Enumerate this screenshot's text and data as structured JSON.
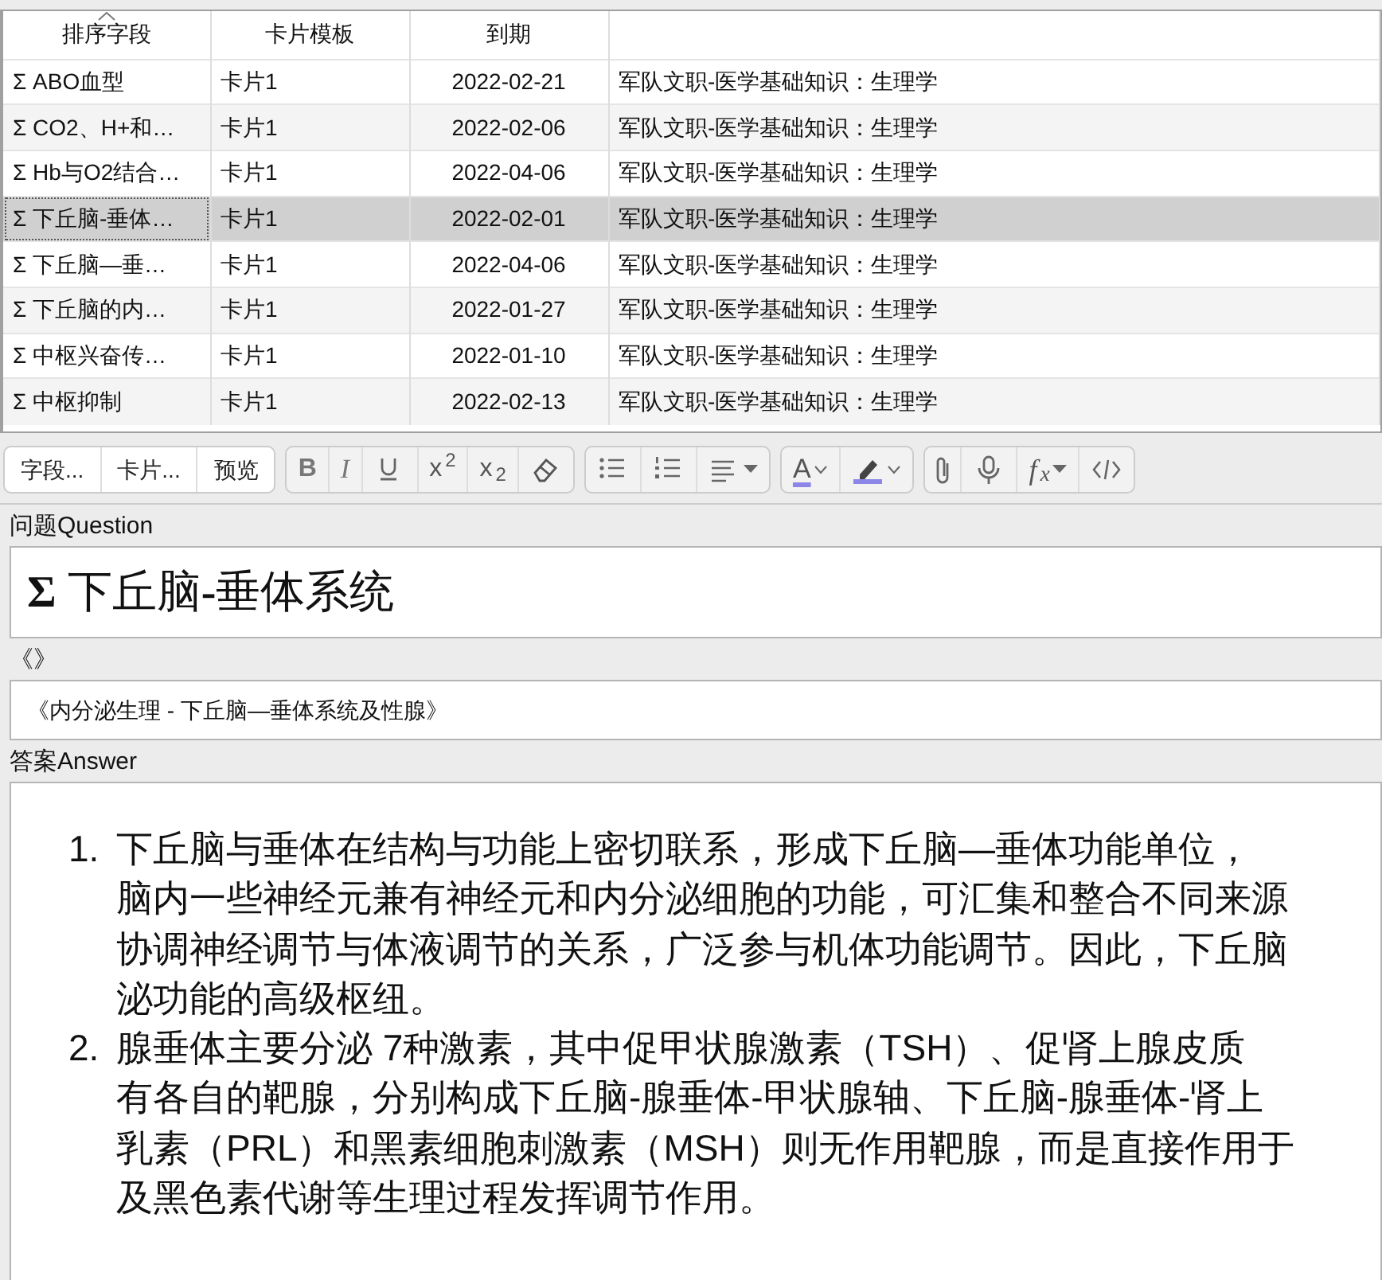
{
  "table": {
    "columns": [
      {
        "label": "排序字段",
        "sorted": true
      },
      {
        "label": "卡片模板",
        "sorted": false
      },
      {
        "label": "到期",
        "sorted": false
      }
    ],
    "rows": [
      {
        "cells": [
          "Σ ABO血型",
          "卡片1",
          "2022-02-21",
          "军队文职-医学基础知识：生理学"
        ],
        "selected": false
      },
      {
        "cells": [
          "Σ CO2、H+和…",
          "卡片1",
          "2022-02-06",
          "军队文职-医学基础知识：生理学"
        ],
        "selected": false
      },
      {
        "cells": [
          "Σ Hb与O2结合…",
          "卡片1",
          "2022-04-06",
          "军队文职-医学基础知识：生理学"
        ],
        "selected": false
      },
      {
        "cells": [
          "Σ 下丘脑-垂体…",
          "卡片1",
          "2022-02-01",
          "军队文职-医学基础知识：生理学"
        ],
        "selected": true
      },
      {
        "cells": [
          "Σ 下丘脑—垂…",
          "卡片1",
          "2022-04-06",
          "军队文职-医学基础知识：生理学"
        ],
        "selected": false
      },
      {
        "cells": [
          "Σ 下丘脑的内…",
          "卡片1",
          "2022-01-27",
          "军队文职-医学基础知识：生理学"
        ],
        "selected": false
      },
      {
        "cells": [
          "Σ 中枢兴奋传…",
          "卡片1",
          "2022-01-10",
          "军队文职-医学基础知识：生理学"
        ],
        "selected": false
      },
      {
        "cells": [
          "Σ 中枢抑制",
          "卡片1",
          "2022-02-13",
          "军队文职-医学基础知识：生理学"
        ],
        "selected": false
      }
    ]
  },
  "toolbar": {
    "text_buttons": [
      "字段...",
      "卡片...",
      "预览"
    ],
    "groups": [
      [
        {
          "kind": "bold",
          "glyph": "B"
        },
        {
          "kind": "italic",
          "glyph": "I"
        },
        {
          "kind": "underline"
        },
        {
          "kind": "superscript",
          "glyph": "x$^{2}$"
        },
        {
          "kind": "subscript",
          "glyph": "x$_{2}$"
        },
        {
          "kind": "eraser"
        }
      ],
      [
        {
          "kind": "bullets"
        },
        {
          "kind": "numbers"
        },
        {
          "kind": "align"
        }
      ],
      [
        {
          "kind": "text-color",
          "glyph": "A"
        },
        {
          "kind": "highlight"
        }
      ],
      [
        {
          "kind": "attach"
        },
        {
          "kind": "mic"
        },
        {
          "kind": "formula",
          "glyph": "f$_{x}$"
        },
        {
          "kind": "html"
        }
      ]
    ]
  },
  "fields": [
    {
      "label": "问题Question",
      "value": "**Σ** 下丘脑**-**垂体系统",
      "kind": "big"
    },
    {
      "label": "《》",
      "value": "《内分泌生理 - 下丘脑—垂体系统及性腺》",
      "kind": "small"
    }
  ],
  "answer": {
    "label": "答案Answer",
    "items": [
      {
        "number": "1.",
        "lines": [
          "下丘脑与垂体在结构与功能上密切联系，形成下丘脑—垂体功能单位，",
          "脑内一些神经元兼有神经元和内分泌细胞的功能，可汇集和整合不同来源",
          "协调神经调节与体液调节的关系，广泛参与机体功能调节。因此，下丘脑",
          "泌功能的高级枢纽。"
        ]
      },
      {
        "number": "2.",
        "lines": [
          "腺垂体主要分泌 7种激素，其中促甲状腺激素（TSH）、促肾上腺皮质",
          "有各自的靶腺，分别构成下丘脑-腺垂体-甲状腺轴、下丘脑-腺垂体-肾上",
          "乳素（PRL）和黑素细胞刺激素（MSH）则无作用靶腺，而是直接作用于",
          "及黑色素代谢等生理过程发挥调节作用。"
        ]
      }
    ]
  }
}
